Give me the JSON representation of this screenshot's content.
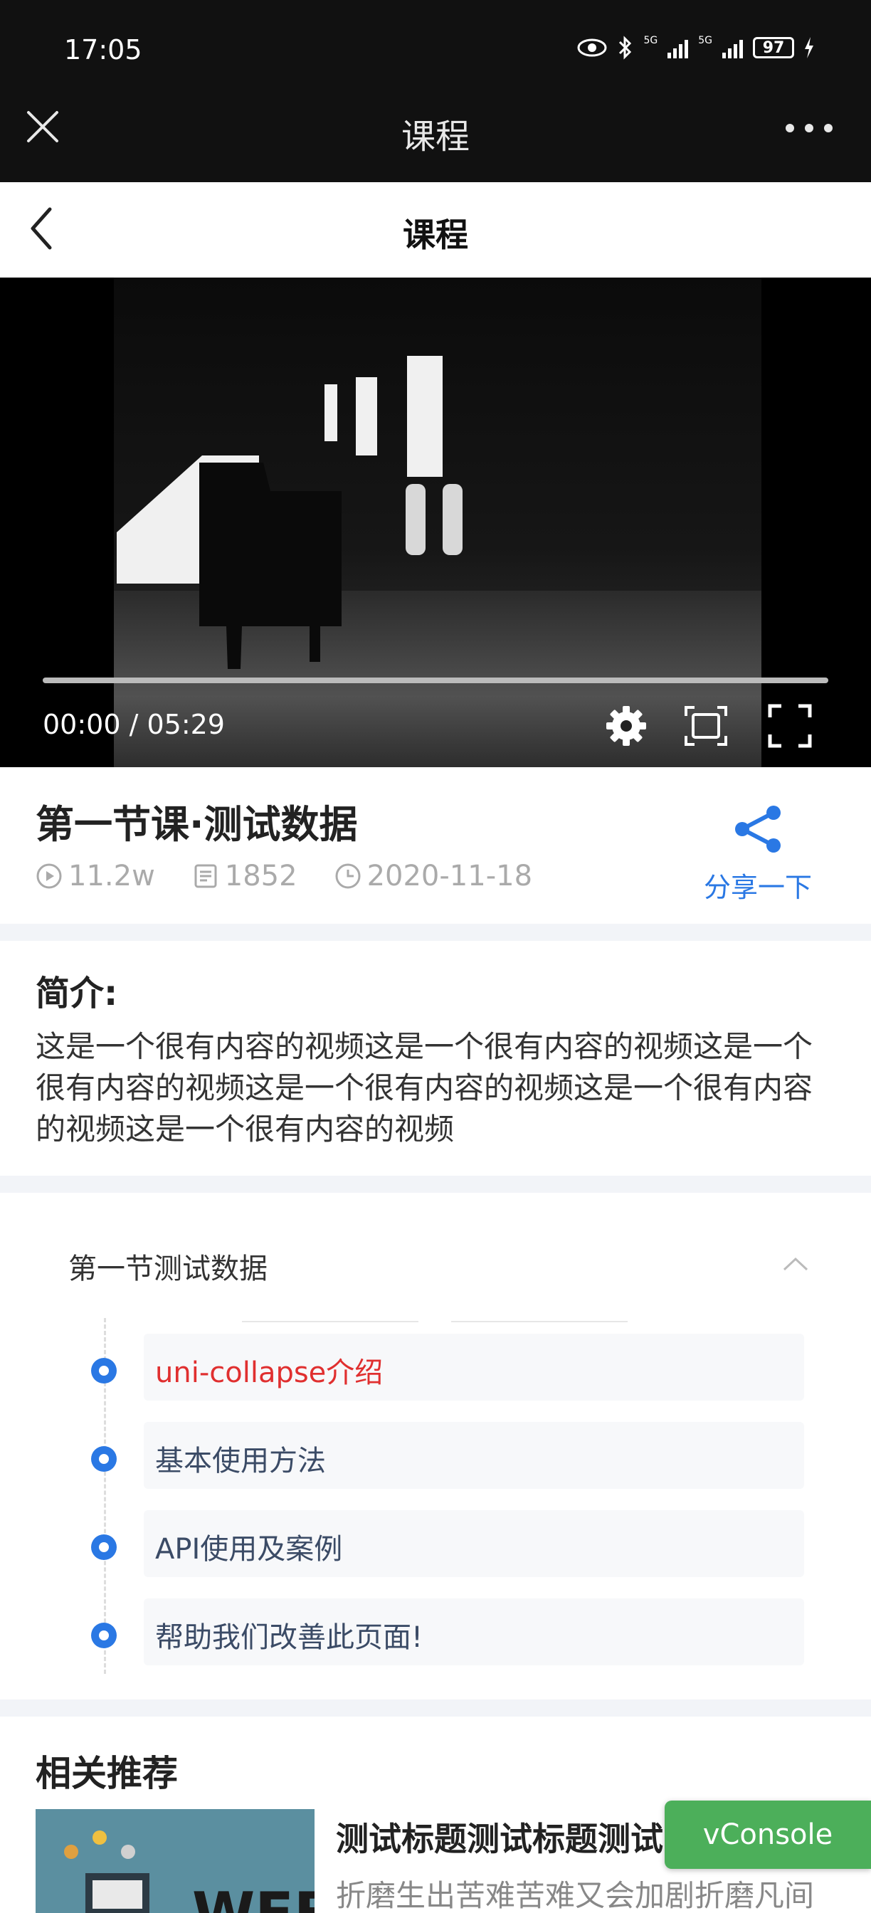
{
  "status_bar": {
    "time": "17:05",
    "battery": "97",
    "signal_1_label": "5G",
    "signal_2_label": "5G"
  },
  "top_bar": {
    "title": "课程"
  },
  "page_header": {
    "title": "课程"
  },
  "video": {
    "time_display": "00:00 / 05:29",
    "progress": 0.0
  },
  "lesson": {
    "title": "第一节课·测试数据",
    "views": "11.2w",
    "comments": "1852",
    "date": "2020-11-18",
    "share_label": "分享一下"
  },
  "intro": {
    "title": "简介:",
    "text": "这是一个很有内容的视频这是一个很有内容的视频这是一个很有内容的视频这是一个很有内容的视频这是一个很有内容的视频这是一个很有内容的视频"
  },
  "collapse": {
    "heading": "第一节测试数据",
    "items": [
      {
        "label": "uni-collapse介绍",
        "active": true
      },
      {
        "label": "基本使用方法",
        "active": false
      },
      {
        "label": "API使用及案例",
        "active": false
      },
      {
        "label": "帮助我们改善此页面!",
        "active": false
      }
    ]
  },
  "related": {
    "title": "相关推荐",
    "items": [
      {
        "title": "测试标题测试标题测试",
        "desc": "折磨生出苦难苦难又会加剧折磨凡间",
        "thumb_text": "WEB"
      }
    ]
  },
  "vconsole": {
    "label": "vConsole"
  },
  "colors": {
    "accent": "#2a78e4",
    "active_item": "#e02f2f",
    "vconsole": "#4caf5a"
  },
  "icons": [
    "close-icon",
    "more-icon",
    "back-icon",
    "pause-icon",
    "settings-icon",
    "screen-fit-icon",
    "fullscreen-icon",
    "play-count-icon",
    "comment-icon",
    "clock-icon",
    "share-icon",
    "chevron-up-icon"
  ]
}
